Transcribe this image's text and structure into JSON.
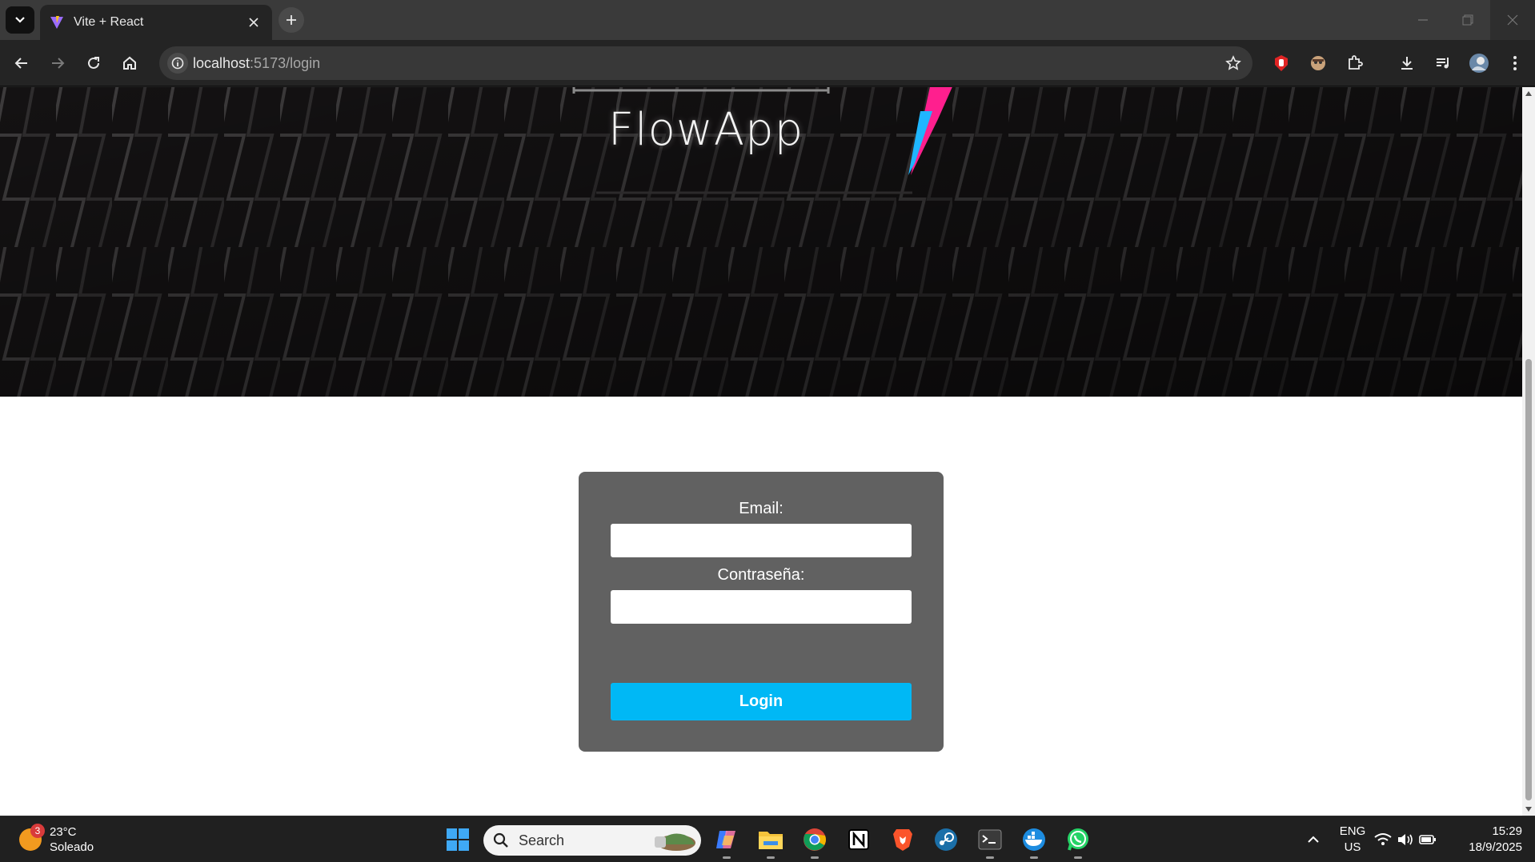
{
  "browser": {
    "tab_title": "Vite + React",
    "url_host": "localhost",
    "url_path": ":5173/login"
  },
  "page": {
    "brand": "FlowApp",
    "form": {
      "email_label": "Email:",
      "email_value": "",
      "password_label": "Contraseña:",
      "password_value": "",
      "submit_label": "Login"
    },
    "colors": {
      "card_bg": "#616161",
      "button_bg": "#00b8f5",
      "hero_bg": "#141213",
      "accent_pink": "#ff1f8e",
      "accent_cyan": "#1fb6ff"
    }
  },
  "taskbar": {
    "weather_badge": "3",
    "weather_temp": "23°C",
    "weather_desc": "Soleado",
    "search_placeholder": "Search",
    "lang_line1": "ENG",
    "lang_line2": "US",
    "time": "15:29",
    "date": "18/9/2025",
    "icons": [
      "windows-start-icon",
      "copilot-icon",
      "file-explorer-icon",
      "chrome-icon",
      "notion-icon",
      "brave-icon",
      "steam-icon",
      "terminal-icon",
      "docker-icon",
      "whatsapp-icon"
    ]
  }
}
